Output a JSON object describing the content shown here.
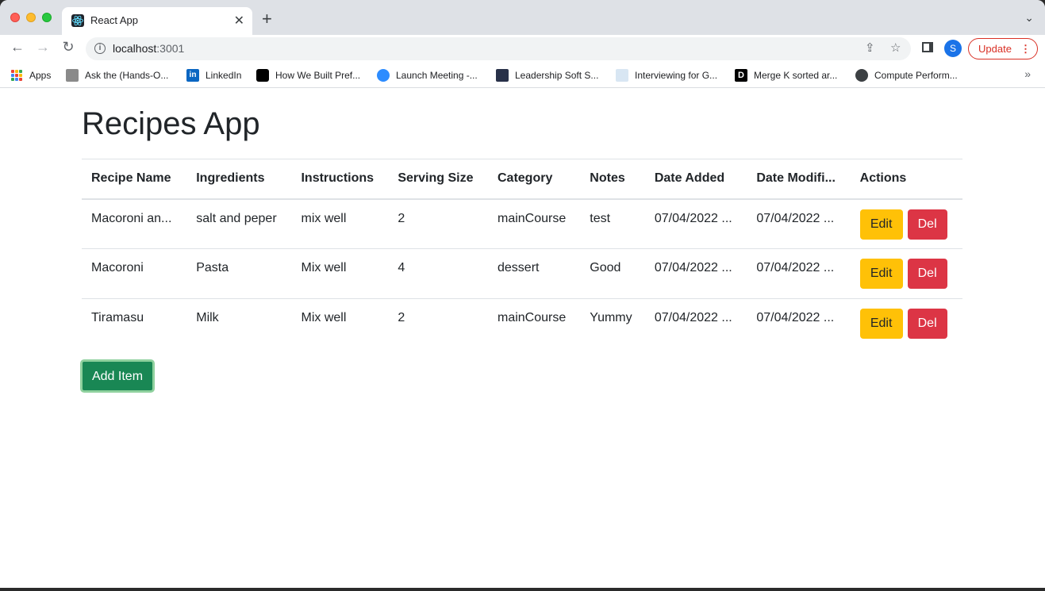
{
  "browser": {
    "tab_title": "React App",
    "url_host": "localhost",
    "url_port": ":3001",
    "update_label": "Update",
    "profile_initial": "S",
    "bookmarks": [
      {
        "label": "Apps",
        "icon": "apps-grid-icon"
      },
      {
        "label": "Ask the (Hands-O...",
        "icon": "avatar-icon"
      },
      {
        "label": "LinkedIn",
        "icon": "linkedin-icon"
      },
      {
        "label": "How We Built Pref...",
        "icon": "medium-icon"
      },
      {
        "label": "Launch Meeting -...",
        "icon": "zoom-icon"
      },
      {
        "label": "Leadership Soft S...",
        "icon": "leadership-icon"
      },
      {
        "label": "Interviewing for G...",
        "icon": "interview-icon"
      },
      {
        "label": "Merge K sorted ar...",
        "icon": "d-icon"
      },
      {
        "label": "Compute Perform...",
        "icon": "globe-icon"
      }
    ]
  },
  "app": {
    "title": "Recipes App",
    "columns": [
      "Recipe Name",
      "Ingredients",
      "Instructions",
      "Serving Size",
      "Category",
      "Notes",
      "Date Added",
      "Date Modifi...",
      "Actions"
    ],
    "rows": [
      [
        "Macoroni an...",
        "salt and peper",
        "mix well",
        "2",
        "mainCourse",
        "test",
        "07/04/2022 ...",
        "07/04/2022 ..."
      ],
      [
        "Macoroni",
        "Pasta",
        "Mix well",
        "4",
        "dessert",
        "Good",
        "07/04/2022 ...",
        "07/04/2022 ..."
      ],
      [
        "Tiramasu",
        "Milk",
        "Mix well",
        "2",
        "mainCourse",
        "Yummy",
        "07/04/2022 ...",
        "07/04/2022 ..."
      ]
    ],
    "edit_label": "Edit",
    "delete_label": "Del",
    "add_label": "Add Item"
  },
  "colors": {
    "edit": "#ffc107",
    "delete": "#dc3545",
    "add": "#198754"
  }
}
